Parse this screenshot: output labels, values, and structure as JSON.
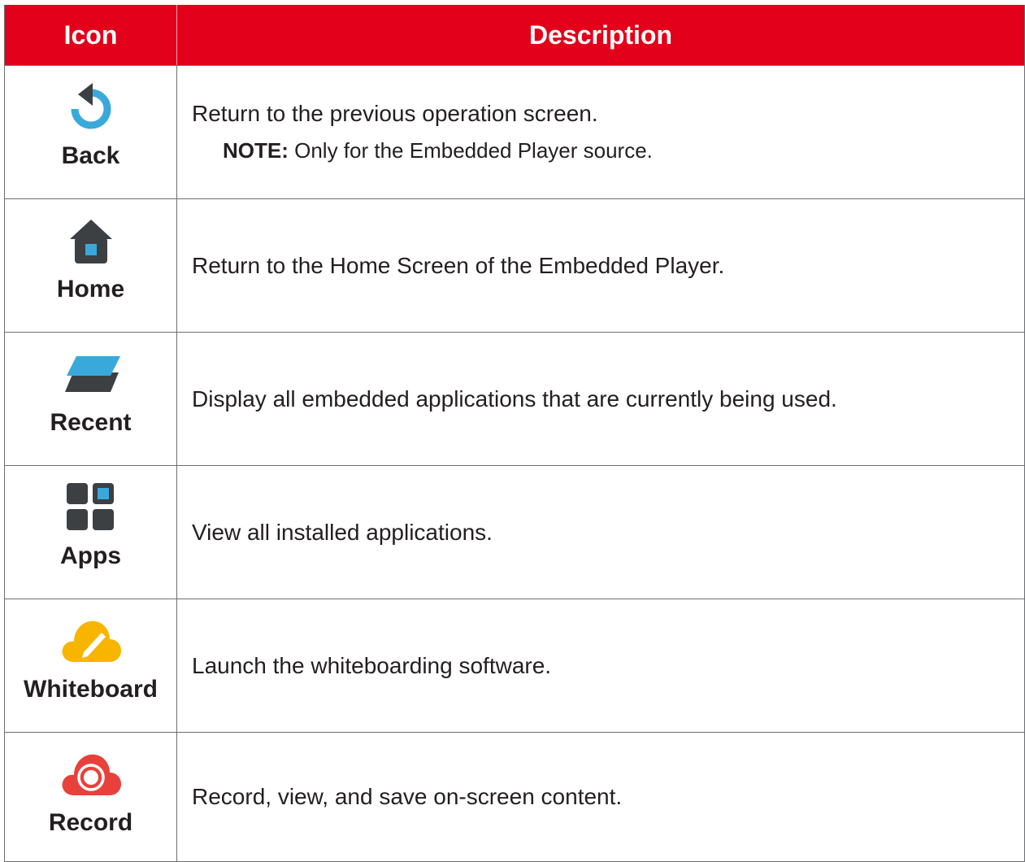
{
  "header": {
    "col_icon": "Icon",
    "col_description": "Description"
  },
  "rows": [
    {
      "icon": "back-icon",
      "name": "Back",
      "description": "Return to the previous operation screen.",
      "note_label": "NOTE:",
      "note_text": " Only for the Embedded Player source."
    },
    {
      "icon": "home-icon",
      "name": "Home",
      "description": "Return to the Home Screen of the Embedded Player."
    },
    {
      "icon": "recent-icon",
      "name": "Recent",
      "description": "Display all embedded applications that are currently being used."
    },
    {
      "icon": "apps-icon",
      "name": "Apps",
      "description": "View all installed applications."
    },
    {
      "icon": "whiteboard-icon",
      "name": "Whiteboard",
      "description": "Launch the whiteboarding software."
    },
    {
      "icon": "record-icon",
      "name": "Record",
      "description": "Record, view, and save on-screen content."
    }
  ],
  "colors": {
    "header_red": "#e2001a",
    "icon_dark": "#3c4043",
    "icon_blue": "#39a9dc",
    "whiteboard_yellow": "#f7b500",
    "record_red": "#e8413c"
  }
}
